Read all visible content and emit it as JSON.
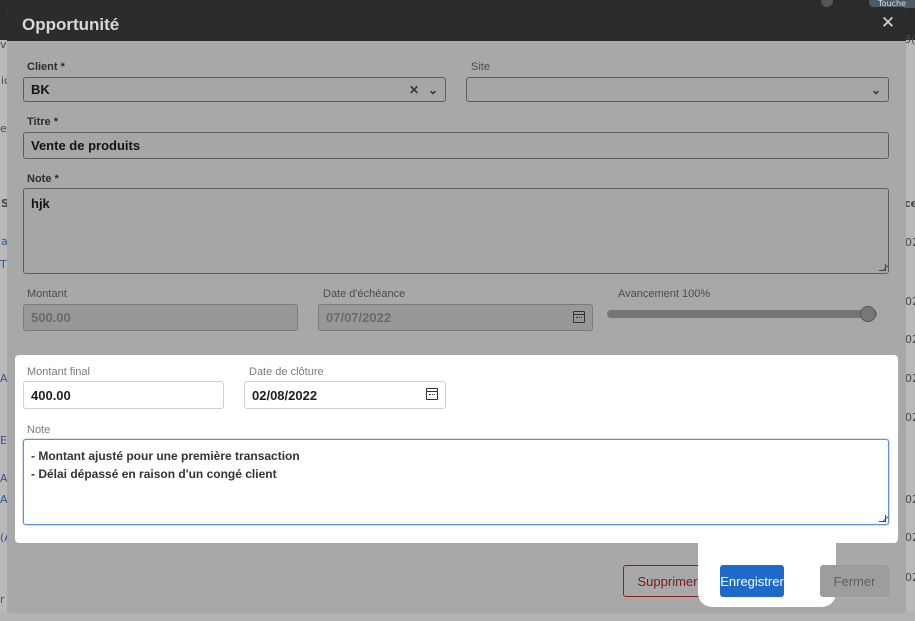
{
  "background": {
    "badge_text": "Touche",
    "left_fragments": [
      "v",
      "ic",
      "es",
      "S",
      "a",
      "T",
      "A",
      "E",
      "A",
      "A",
      "(A",
      "r"
    ],
    "right_fragments": [
      "3(",
      "ce",
      "02",
      "02",
      "02",
      "02",
      "02",
      "02",
      "02",
      "02"
    ]
  },
  "modal": {
    "title": "Opportunité",
    "close_icon": "close-icon"
  },
  "form": {
    "client": {
      "label": "Client *",
      "value": "BK"
    },
    "site": {
      "label": "Site",
      "value": ""
    },
    "title": {
      "label": "Titre *",
      "value": "Vente de produits"
    },
    "note": {
      "label": "Note *",
      "value": "hjk"
    },
    "amount": {
      "label": "Montant",
      "value": "500.00"
    },
    "due_date": {
      "label": "Date d'échéance",
      "value": "07/07/2022"
    },
    "progress": {
      "label": "Avancement 100%",
      "value_percent": 100
    }
  },
  "closing": {
    "final_amount": {
      "label": "Montant final",
      "value": "400.00"
    },
    "close_date": {
      "label": "Date de clôture",
      "value": "02/08/2022"
    },
    "note": {
      "label": "Note",
      "lines": [
        "- Montant ajusté pour une première transaction",
        "- Délai dépassé en raison d'un congé client"
      ]
    }
  },
  "footer": {
    "delete_label": "Supprimer",
    "save_label": "Enregistrer",
    "close_label": "Fermer"
  },
  "colors": {
    "primary": "#1e69c9",
    "danger": "#8a1f1f",
    "focus": "#5b8fd6"
  }
}
